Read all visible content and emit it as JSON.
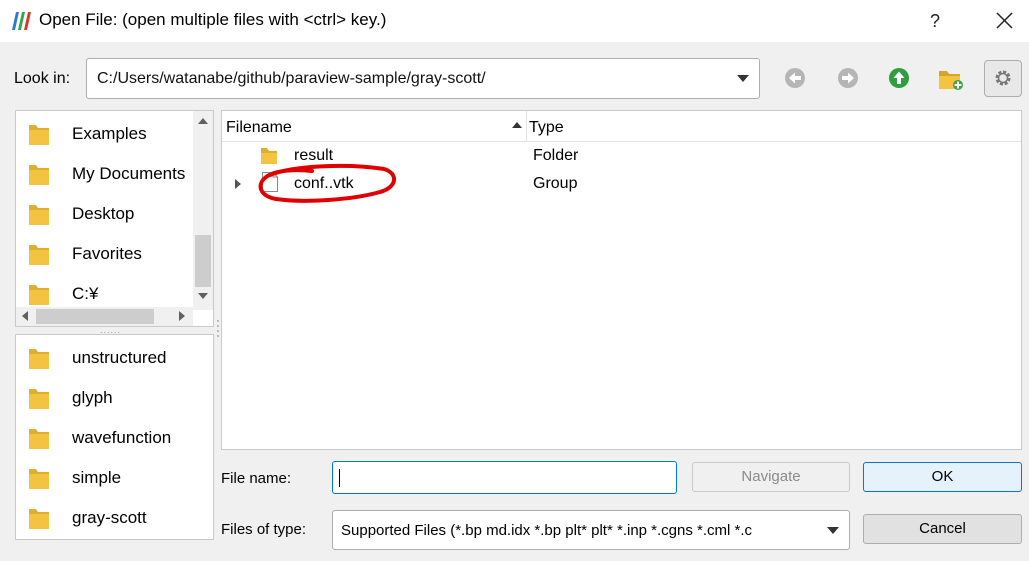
{
  "window": {
    "title": "Open File:  (open multiple files with <ctrl> key.)",
    "help_label": "?"
  },
  "look_in": {
    "label": "Look in:",
    "path": "C:/Users/watanabe/github/paraview-sample/gray-scott/"
  },
  "places": [
    {
      "label": "Examples"
    },
    {
      "label": "My Documents"
    },
    {
      "label": "Desktop"
    },
    {
      "label": "Favorites"
    },
    {
      "label": "C:¥"
    }
  ],
  "recent": [
    {
      "label": "unstructured"
    },
    {
      "label": "glyph"
    },
    {
      "label": "wavefunction"
    },
    {
      "label": "simple"
    },
    {
      "label": "gray-scott"
    }
  ],
  "file_list": {
    "columns": {
      "filename": "Filename",
      "type": "Type"
    },
    "rows": [
      {
        "name": "result",
        "type": "Folder",
        "icon": "folder-icon"
      },
      {
        "name": "conf..vtk",
        "type": "Group",
        "icon": "file-icon",
        "expandable": true,
        "highlighted": true
      }
    ]
  },
  "file_name": {
    "label": "File name:",
    "value": ""
  },
  "file_type": {
    "label": "Files of type:",
    "value": "Supported Files (*.bp md.idx *.bp plt* plt* *.inp *.cgns *.cml *.c"
  },
  "buttons": {
    "navigate": "Navigate",
    "ok": "OK",
    "cancel": "Cancel"
  },
  "colors": {
    "folder": "#f5c342",
    "nav_arrow_disabled": "#b5b5b5",
    "up_arrow": "#2e9e3e",
    "annotation": "#e00000",
    "focus": "#0078d7"
  }
}
